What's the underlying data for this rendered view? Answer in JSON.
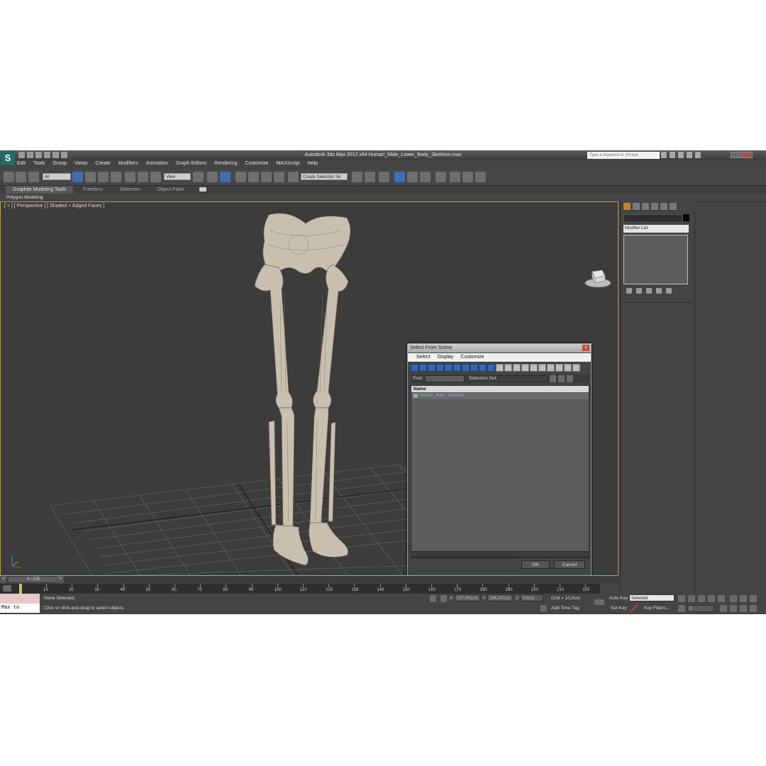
{
  "window": {
    "title": "Autodesk 3ds Max  2012 x64     Human_Male_Lower_Body_Skeleton.max",
    "search_placeholder": "Type a keyword or phrase",
    "logo_letter": "S"
  },
  "menu": [
    "Edit",
    "Tools",
    "Group",
    "Views",
    "Create",
    "Modifiers",
    "Animation",
    "Graph Editors",
    "Rendering",
    "Customize",
    "MAXScript",
    "Help"
  ],
  "toolbar": {
    "filter_value": "All",
    "refcoord_value": "View",
    "selection_set_value": "Create Selection Se"
  },
  "ribbon": {
    "tabs": [
      "Graphite Modeling Tools",
      "Freeform",
      "Selection",
      "Object Paint"
    ],
    "sub_label": "Polygon Modeling"
  },
  "viewport": {
    "label": "[ + ] [ Perspective ] [ Shaded + Edged Faces ]",
    "border_color": "#c8a030"
  },
  "command_panel": {
    "modifier_list": "Modifier List"
  },
  "dialog": {
    "title": "Select From Scene",
    "menu": [
      "Select",
      "Display",
      "Customize"
    ],
    "find_label": "Find:",
    "selection_set_label": "Selection Set:",
    "column_header": "Name",
    "rows": [
      "Human_Male_Skeleton"
    ],
    "ok_label": "OK",
    "cancel_label": "Cancel"
  },
  "timeline": {
    "slider_text": "0 / 225",
    "ticks": [
      "10",
      "20",
      "30",
      "40",
      "50",
      "60",
      "70",
      "80",
      "90",
      "100",
      "110",
      "120",
      "130",
      "140",
      "150",
      "160",
      "170",
      "180",
      "190",
      "200",
      "210",
      "220"
    ],
    "prev_arrow": "<",
    "next_arrow": ">"
  },
  "status": {
    "maxscript_listener": "Max to Physc.",
    "selection_status": "None Selected",
    "prompt": "Click or click-and-drag to select objects",
    "x_label": "X:",
    "x_value": "157,341cm",
    "y_label": "Y:",
    "y_value": "246,247cm",
    "z_label": "Z:",
    "z_value": "0,0cm",
    "grid": "Grid = 10,0cm",
    "add_time_tag": "Add Time Tag",
    "auto_key": "Auto Key",
    "set_key": "Set Key",
    "key_mode": "Selected",
    "key_filters": "Key Filters...",
    "frame": "0"
  }
}
